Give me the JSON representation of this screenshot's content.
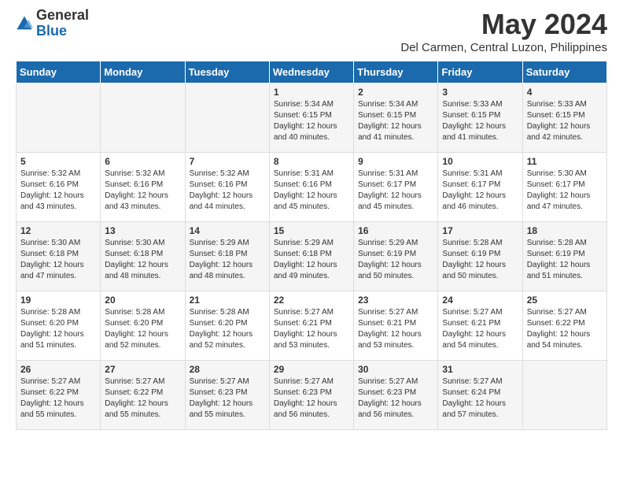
{
  "logo": {
    "general": "General",
    "blue": "Blue"
  },
  "title": "May 2024",
  "location": "Del Carmen, Central Luzon, Philippines",
  "days_header": [
    "Sunday",
    "Monday",
    "Tuesday",
    "Wednesday",
    "Thursday",
    "Friday",
    "Saturday"
  ],
  "weeks": [
    {
      "cells": [
        {
          "day": "",
          "info": ""
        },
        {
          "day": "",
          "info": ""
        },
        {
          "day": "",
          "info": ""
        },
        {
          "day": "1",
          "info": "Sunrise: 5:34 AM\nSunset: 6:15 PM\nDaylight: 12 hours\nand 40 minutes."
        },
        {
          "day": "2",
          "info": "Sunrise: 5:34 AM\nSunset: 6:15 PM\nDaylight: 12 hours\nand 41 minutes."
        },
        {
          "day": "3",
          "info": "Sunrise: 5:33 AM\nSunset: 6:15 PM\nDaylight: 12 hours\nand 41 minutes."
        },
        {
          "day": "4",
          "info": "Sunrise: 5:33 AM\nSunset: 6:15 PM\nDaylight: 12 hours\nand 42 minutes."
        }
      ]
    },
    {
      "cells": [
        {
          "day": "5",
          "info": "Sunrise: 5:32 AM\nSunset: 6:16 PM\nDaylight: 12 hours\nand 43 minutes."
        },
        {
          "day": "6",
          "info": "Sunrise: 5:32 AM\nSunset: 6:16 PM\nDaylight: 12 hours\nand 43 minutes."
        },
        {
          "day": "7",
          "info": "Sunrise: 5:32 AM\nSunset: 6:16 PM\nDaylight: 12 hours\nand 44 minutes."
        },
        {
          "day": "8",
          "info": "Sunrise: 5:31 AM\nSunset: 6:16 PM\nDaylight: 12 hours\nand 45 minutes."
        },
        {
          "day": "9",
          "info": "Sunrise: 5:31 AM\nSunset: 6:17 PM\nDaylight: 12 hours\nand 45 minutes."
        },
        {
          "day": "10",
          "info": "Sunrise: 5:31 AM\nSunset: 6:17 PM\nDaylight: 12 hours\nand 46 minutes."
        },
        {
          "day": "11",
          "info": "Sunrise: 5:30 AM\nSunset: 6:17 PM\nDaylight: 12 hours\nand 47 minutes."
        }
      ]
    },
    {
      "cells": [
        {
          "day": "12",
          "info": "Sunrise: 5:30 AM\nSunset: 6:18 PM\nDaylight: 12 hours\nand 47 minutes."
        },
        {
          "day": "13",
          "info": "Sunrise: 5:30 AM\nSunset: 6:18 PM\nDaylight: 12 hours\nand 48 minutes."
        },
        {
          "day": "14",
          "info": "Sunrise: 5:29 AM\nSunset: 6:18 PM\nDaylight: 12 hours\nand 48 minutes."
        },
        {
          "day": "15",
          "info": "Sunrise: 5:29 AM\nSunset: 6:18 PM\nDaylight: 12 hours\nand 49 minutes."
        },
        {
          "day": "16",
          "info": "Sunrise: 5:29 AM\nSunset: 6:19 PM\nDaylight: 12 hours\nand 50 minutes."
        },
        {
          "day": "17",
          "info": "Sunrise: 5:28 AM\nSunset: 6:19 PM\nDaylight: 12 hours\nand 50 minutes."
        },
        {
          "day": "18",
          "info": "Sunrise: 5:28 AM\nSunset: 6:19 PM\nDaylight: 12 hours\nand 51 minutes."
        }
      ]
    },
    {
      "cells": [
        {
          "day": "19",
          "info": "Sunrise: 5:28 AM\nSunset: 6:20 PM\nDaylight: 12 hours\nand 51 minutes."
        },
        {
          "day": "20",
          "info": "Sunrise: 5:28 AM\nSunset: 6:20 PM\nDaylight: 12 hours\nand 52 minutes."
        },
        {
          "day": "21",
          "info": "Sunrise: 5:28 AM\nSunset: 6:20 PM\nDaylight: 12 hours\nand 52 minutes."
        },
        {
          "day": "22",
          "info": "Sunrise: 5:27 AM\nSunset: 6:21 PM\nDaylight: 12 hours\nand 53 minutes."
        },
        {
          "day": "23",
          "info": "Sunrise: 5:27 AM\nSunset: 6:21 PM\nDaylight: 12 hours\nand 53 minutes."
        },
        {
          "day": "24",
          "info": "Sunrise: 5:27 AM\nSunset: 6:21 PM\nDaylight: 12 hours\nand 54 minutes."
        },
        {
          "day": "25",
          "info": "Sunrise: 5:27 AM\nSunset: 6:22 PM\nDaylight: 12 hours\nand 54 minutes."
        }
      ]
    },
    {
      "cells": [
        {
          "day": "26",
          "info": "Sunrise: 5:27 AM\nSunset: 6:22 PM\nDaylight: 12 hours\nand 55 minutes."
        },
        {
          "day": "27",
          "info": "Sunrise: 5:27 AM\nSunset: 6:22 PM\nDaylight: 12 hours\nand 55 minutes."
        },
        {
          "day": "28",
          "info": "Sunrise: 5:27 AM\nSunset: 6:23 PM\nDaylight: 12 hours\nand 55 minutes."
        },
        {
          "day": "29",
          "info": "Sunrise: 5:27 AM\nSunset: 6:23 PM\nDaylight: 12 hours\nand 56 minutes."
        },
        {
          "day": "30",
          "info": "Sunrise: 5:27 AM\nSunset: 6:23 PM\nDaylight: 12 hours\nand 56 minutes."
        },
        {
          "day": "31",
          "info": "Sunrise: 5:27 AM\nSunset: 6:24 PM\nDaylight: 12 hours\nand 57 minutes."
        },
        {
          "day": "",
          "info": ""
        }
      ]
    }
  ]
}
